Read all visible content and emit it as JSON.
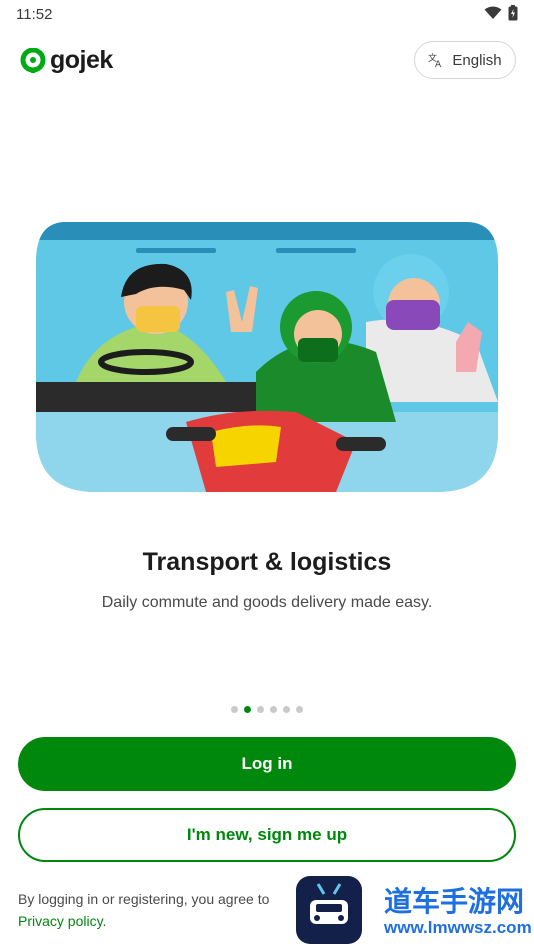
{
  "status": {
    "time": "11:52"
  },
  "header": {
    "brand": "gojek",
    "language_label": "English"
  },
  "onboarding": {
    "title": "Transport & logistics",
    "subtitle": "Daily commute and goods delivery made easy.",
    "page_count": 6,
    "active_page": 2
  },
  "actions": {
    "login_label": "Log in",
    "signup_label": "I'm new, sign me up"
  },
  "legal": {
    "prefix": "By logging in or registering, you agree to",
    "privacy_link": "Privacy policy",
    "suffix": "."
  },
  "watermark": {
    "line1": "道车手游网",
    "line2": "www.lmwwsz.com"
  },
  "colors": {
    "brand_green": "#00880d",
    "sky": "#5ec8e6"
  }
}
